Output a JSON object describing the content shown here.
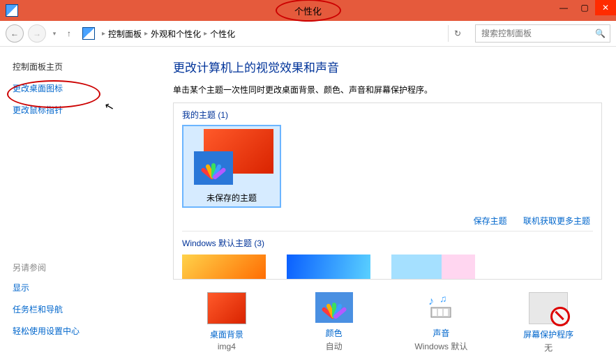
{
  "window": {
    "title": "个性化"
  },
  "breadcrumbs": {
    "items": [
      "控制面板",
      "外观和个性化",
      "个性化"
    ]
  },
  "search": {
    "placeholder": "搜索控制面板"
  },
  "sidebar": {
    "home": "控制面板主页",
    "links": [
      "更改桌面图标",
      "更改鼠标指针"
    ],
    "see_also_hdr": "另请参阅",
    "see_also": [
      "显示",
      "任务栏和导航",
      "轻松使用设置中心"
    ]
  },
  "main": {
    "heading": "更改计算机上的视觉效果和声音",
    "subtext": "单击某个主题一次性同时更改桌面背景、颜色、声音和屏幕保护程序。",
    "my_themes_hdr": "我的主题 (1)",
    "unsaved_theme": "未保存的主题",
    "save_theme": "保存主题",
    "get_more": "联机获取更多主题",
    "default_hdr": "Windows 默认主题 (3)"
  },
  "bottom": {
    "items": [
      {
        "label": "桌面背景",
        "value": "img4"
      },
      {
        "label": "颜色",
        "value": "自动"
      },
      {
        "label": "声音",
        "value": "Windows 默认"
      },
      {
        "label": "屏幕保护程序",
        "value": "无"
      }
    ]
  }
}
